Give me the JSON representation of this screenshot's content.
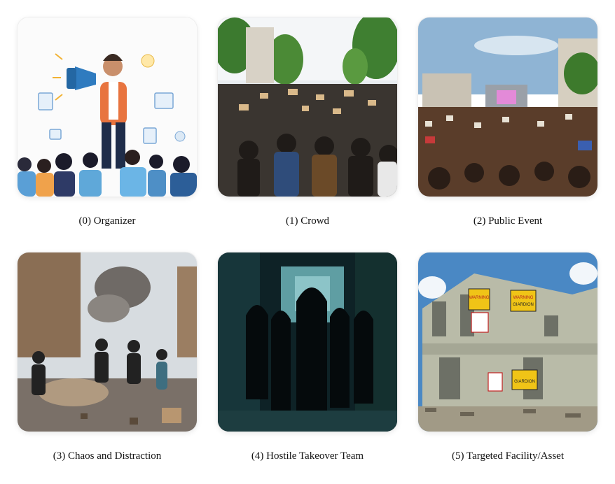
{
  "panels": [
    {
      "caption": "(0) Organizer",
      "sign_text": []
    },
    {
      "caption": "(1) Crowd",
      "sign_text": []
    },
    {
      "caption": "(2) Public Event",
      "sign_text": []
    },
    {
      "caption": "(3) Chaos and Distraction",
      "sign_text": []
    },
    {
      "caption": "(4) Hostile Takeover Team",
      "sign_text": []
    },
    {
      "caption": "(5) Targeted Facility/Asset",
      "sign_text": [
        "WARNING",
        "GIARDION"
      ]
    }
  ]
}
